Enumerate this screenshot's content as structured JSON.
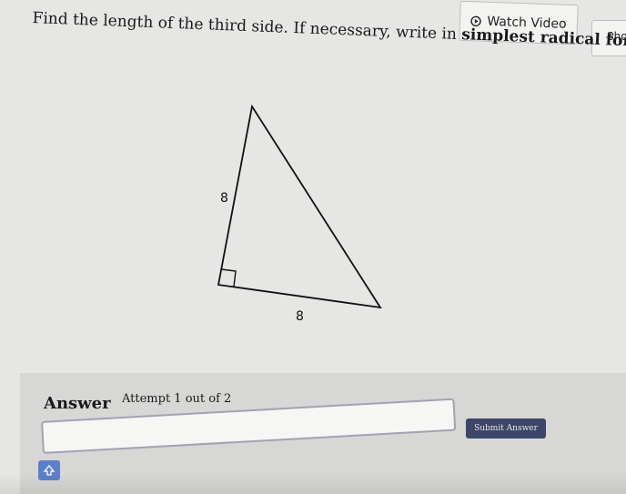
{
  "header": {
    "watch_video_label": "Watch Video",
    "show_examples_label": "Sho"
  },
  "question": {
    "text_part1": "Find the length of the third side. If necessary, write in ",
    "text_emphasis": "simplest radical form."
  },
  "figure": {
    "leg_vertical_label": "8",
    "leg_horizontal_label": "8"
  },
  "answer": {
    "label": "Answer",
    "attempt_text": "Attempt 1 out of 2",
    "input_value": "",
    "submit_label": "Submit Answer"
  },
  "icons": {
    "play": "play-circle-icon",
    "keyboard": "keyboard-toggle-icon"
  },
  "colors": {
    "submit_bg": "#3d4668",
    "keyboard_bg": "#5c80c8",
    "input_border": "#9fa3b2"
  }
}
